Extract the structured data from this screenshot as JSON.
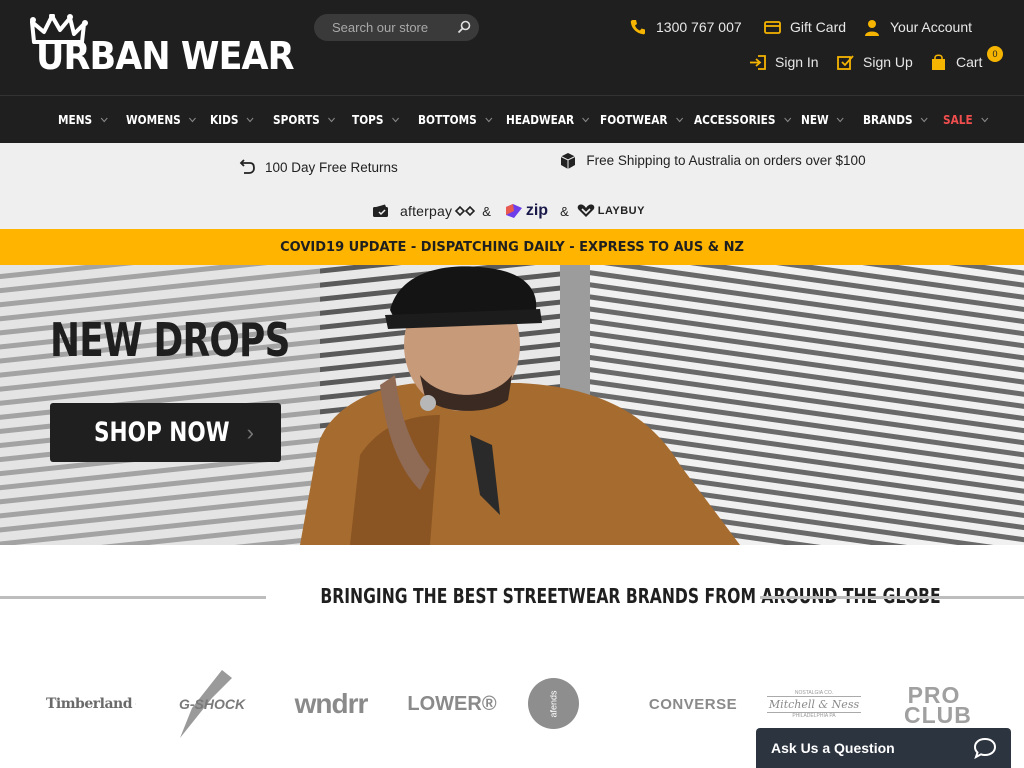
{
  "header": {
    "logo_text": "URBAN WEAR",
    "search_placeholder": "Search our store",
    "phone": "1300 767 007",
    "gift_card": "Gift Card",
    "account": "Your Account",
    "sign_in": "Sign In",
    "sign_up": "Sign Up",
    "cart": "Cart",
    "cart_count": "0"
  },
  "nav": {
    "items": [
      {
        "label": "MENS"
      },
      {
        "label": "WOMENS"
      },
      {
        "label": "KIDS"
      },
      {
        "label": "SPORTS"
      },
      {
        "label": "TOPS"
      },
      {
        "label": "BOTTOMS"
      },
      {
        "label": "HEADWEAR"
      },
      {
        "label": "FOOTWEAR"
      },
      {
        "label": "ACCESSORIES"
      },
      {
        "label": "NEW"
      },
      {
        "label": "BRANDS"
      },
      {
        "label": "SALE"
      }
    ]
  },
  "usp": {
    "returns": "100 Day Free Returns",
    "shipping": "Free Shipping to Australia on orders over $100",
    "afterpay": "afterpay",
    "amp": "&",
    "zip": "zip",
    "laybuy": "LAYBUY"
  },
  "covid_banner": "COVID19 UPDATE - DISPATCHING DAILY - EXPRESS TO AUS & NZ",
  "hero": {
    "title": "NEW DROPS",
    "button": "SHOP NOW"
  },
  "brands": {
    "heading": "BRINGING THE BEST STREETWEAR BRANDS FROM AROUND THE GLOBE",
    "logos": [
      "Timberland",
      "G-SHOCK",
      "wndrr",
      "LOWER®",
      "afends",
      "CONVERSE",
      "Mitchell & Ness",
      "PRO CLUB"
    ],
    "mn_small_top": "NOSTALGIA CO.",
    "mn_small_bottom": "PHILADELPHIA PA"
  },
  "chat": {
    "label": "Ask Us a Question"
  },
  "colors": {
    "header_bg": "#1f1f1f",
    "accent": "#ffb400",
    "sale": "#f04e4e",
    "usp_bg": "#efefef",
    "chat_bg": "#2c3440"
  }
}
